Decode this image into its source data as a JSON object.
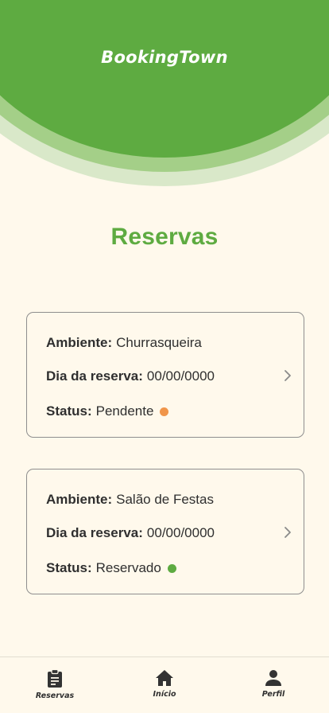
{
  "header": {
    "brand": "BookingTown"
  },
  "page": {
    "title": "Reservas"
  },
  "labels": {
    "ambiente": "Ambiente:",
    "dia": "Dia da reserva:",
    "status": "Status:"
  },
  "reservations": [
    {
      "ambiente": "Churrasqueira",
      "dia": "00/00/0000",
      "status": "Pendente",
      "status_color": "#f0954a"
    },
    {
      "ambiente": "Salão de Festas",
      "dia": "00/00/0000",
      "status": "Reservado",
      "status_color": "#5eab41"
    }
  ],
  "nav": {
    "items": [
      {
        "label": "Reservas",
        "icon": "clipboard-icon"
      },
      {
        "label": "Início",
        "icon": "home-icon"
      },
      {
        "label": "Perfil",
        "icon": "user-icon"
      }
    ]
  },
  "colors": {
    "primary": "#5eab41",
    "background": "#fff9ec",
    "pending": "#f0954a",
    "reserved": "#5eab41"
  }
}
